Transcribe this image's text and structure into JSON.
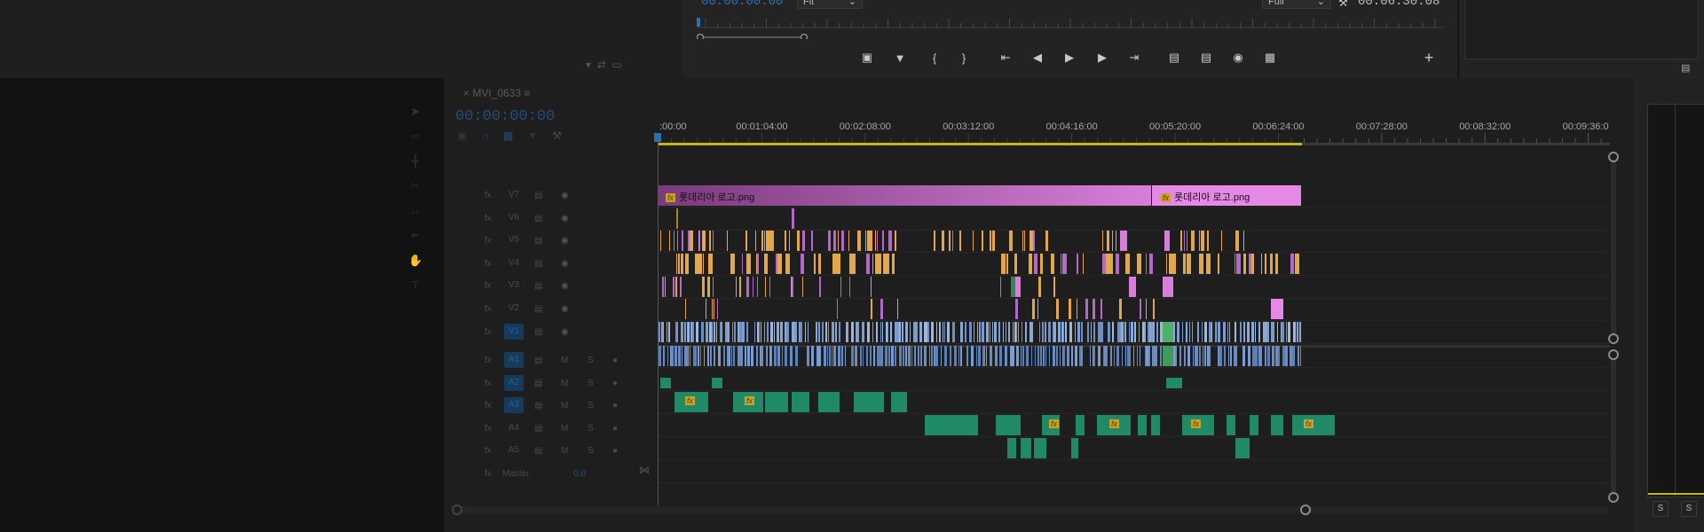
{
  "program_monitor": {
    "timecode": "00:00:00:00",
    "fit_label": "Fit",
    "resolution_label": "Full",
    "duration": "00:06:30:08",
    "icons": [
      "mark-in-icon",
      "add-marker-icon",
      "mark-in-bracket-icon",
      "mark-out-bracket-icon",
      "go-to-in-icon",
      "step-back-icon",
      "play-icon",
      "step-forward-icon",
      "go-to-out-icon",
      "lift-icon",
      "extract-icon",
      "export-frame-icon",
      "comparison-view-icon",
      "add-button-icon"
    ]
  },
  "timeline": {
    "sequence_name": "MVI_0633",
    "timecode": "00:00:00:00",
    "ruler_labels": [
      ":00:00",
      "00:01:04:00",
      "00:02:08:00",
      "00:03:12:00",
      "00:04:16:00",
      "00:05:20:00",
      "00:06:24:00",
      "00:07:28:00",
      "00:08:32:00",
      "00:09:36:0"
    ],
    "video_tracks": [
      "V7",
      "V6",
      "V5",
      "V4",
      "V3",
      "V2",
      "V1"
    ],
    "audio_tracks": [
      "A1",
      "A2",
      "A3",
      "A4",
      "A5"
    ],
    "master_label": "Master",
    "master_value": "0.0",
    "clip_title_1": "롯데리아 로고.png",
    "clip_title_2": "롯데리아 로고.png",
    "fx_label": "fx",
    "mute_label": "M",
    "solo_label": "S"
  },
  "audio_meter": {
    "solo_left": "S",
    "solo_right": "S"
  },
  "colors": {
    "accent_blue": "#2d6fb3",
    "video_blue": "#7b9ccc",
    "graphic_pink": "#d77fd8",
    "clip_orange": "#e3a64a",
    "clip_purple": "#b468c9",
    "audio_green": "#1f8a65",
    "work_area": "#c8b419"
  }
}
